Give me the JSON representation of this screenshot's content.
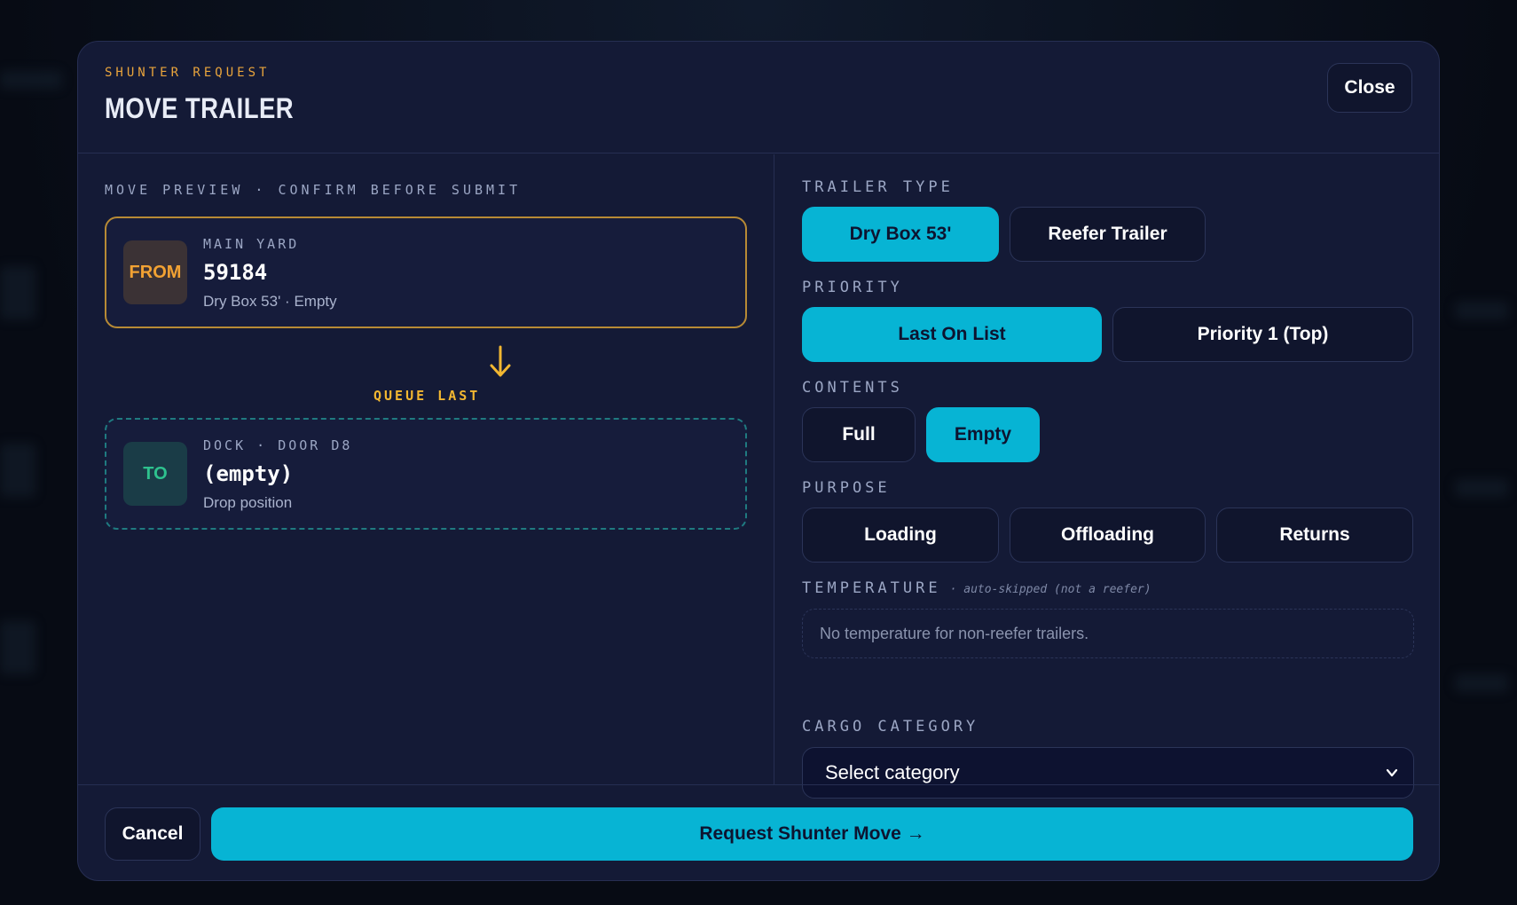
{
  "header": {
    "eyebrow": "SHUNTER REQUEST",
    "title": "MOVE TRAILER",
    "close_label": "Close"
  },
  "preview": {
    "label": "MOVE PREVIEW · CONFIRM BEFORE SUBMIT",
    "from": {
      "chip": "FROM",
      "location": "MAIN YARD",
      "trailer": "59184",
      "details": "Dry Box 53' · Empty"
    },
    "queue_label": "QUEUE LAST",
    "to": {
      "chip": "TO",
      "location": "DOCK · DOOR D8",
      "trailer": "(empty)",
      "details": "Drop position"
    }
  },
  "form": {
    "trailer_type": {
      "label": "TRAILER TYPE",
      "options": [
        "Dry Box 53'",
        "Reefer Trailer"
      ],
      "selected": "Dry Box 53'"
    },
    "priority": {
      "label": "PRIORITY",
      "options": [
        "Last On List",
        "Priority 1 (Top)"
      ],
      "selected": "Last On List"
    },
    "contents": {
      "label": "CONTENTS",
      "options": [
        "Full",
        "Empty"
      ],
      "selected": "Empty"
    },
    "purpose": {
      "label": "PURPOSE",
      "options": [
        "Loading",
        "Offloading",
        "Returns"
      ],
      "selected": ""
    },
    "temperature": {
      "label": "TEMPERATURE",
      "hint": "· auto-skipped (not a reefer)",
      "placeholder": "No temperature for non-reefer trailers."
    },
    "cargo_category": {
      "label": "CARGO CATEGORY",
      "value": "Select category"
    }
  },
  "footer": {
    "cancel_label": "Cancel",
    "submit_label": "Request Shunter Move →"
  },
  "colors": {
    "accent": "#07b4d4",
    "from_accent": "#f2a233",
    "to_accent": "#2ec28e",
    "eyebrow": "#e9a43c"
  }
}
